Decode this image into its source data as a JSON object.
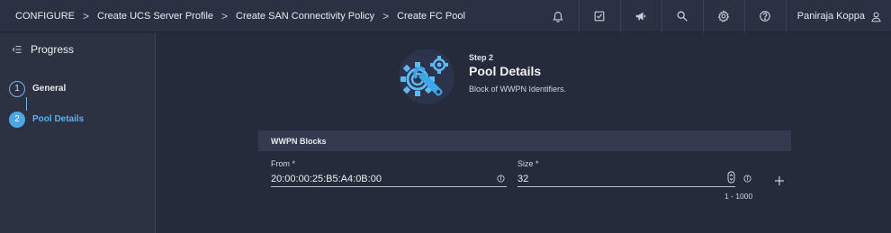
{
  "breadcrumb": {
    "items": [
      "CONFIGURE",
      "Create UCS Server Profile",
      "Create SAN Connectivity Policy",
      "Create FC Pool"
    ],
    "separator": ">"
  },
  "topbar": {
    "icons": [
      "bell-icon",
      "checklist-icon",
      "megaphone-icon",
      "search-icon",
      "gear-icon",
      "help-icon"
    ],
    "user_name": "Paniraja Koppa"
  },
  "sidebar": {
    "title": "Progress",
    "steps": [
      {
        "number": "1",
        "label": "General",
        "state": "done"
      },
      {
        "number": "2",
        "label": "Pool Details",
        "state": "active"
      }
    ]
  },
  "main": {
    "step_small": "Step 2",
    "title": "Pool Details",
    "description": "Block of WWPN Identifiers.",
    "blocks_title": "WWPN Blocks",
    "from": {
      "label": "From *",
      "value": "20:00:00:25:B5:A4:0B:00"
    },
    "size": {
      "label": "Size *",
      "value": "32",
      "range_hint": "1 - 1000"
    }
  },
  "colors": {
    "accent": "#4ca7e8",
    "background": "#262b3b",
    "topbar": "#2b3142",
    "sidebar": "#2d3243"
  }
}
